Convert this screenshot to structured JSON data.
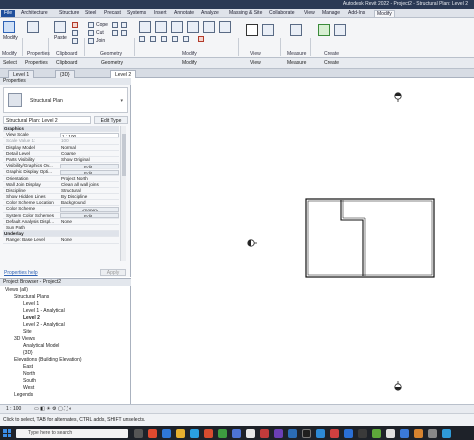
{
  "window": {
    "title": "Autodesk Revit 2022 - Project2 - Structural Plan: Level 2"
  },
  "ribbon_tabs": [
    "File",
    "Architecture",
    "Structure",
    "Steel",
    "Precast",
    "Systems",
    "Insert",
    "Annotate",
    "Analyze",
    "Massing & Site",
    "Collaborate",
    "View",
    "Manage",
    "Add-Ins",
    "Modify"
  ],
  "ribbon": {
    "modify_label": "Modify",
    "properties_label": "Properties",
    "clipboard_label": "Clipboard",
    "geometry_label": "Geometry",
    "modify_group_label": "Modify",
    "view_label": "View",
    "measure_label": "Measure",
    "create_label": "Create",
    "cope": "Cope",
    "cut": "Cut",
    "join": "Join",
    "paste": "Paste"
  },
  "select_bar": {
    "select": "Select",
    "properties": "Properties",
    "clipboard": "Clipboard",
    "geometry": "Geometry",
    "modify": "Modify",
    "view": "View",
    "measure": "Measure",
    "create": "Create"
  },
  "view_tabs": [
    "Level 1",
    "{3D}",
    "Level 2"
  ],
  "properties": {
    "header": "Properties",
    "type_name": "Structural Plan",
    "instance": "Structural Plan: Level 2",
    "edit_type": "Edit Type",
    "rows": [
      {
        "k": "Graphics",
        "v": "",
        "kind": "group"
      },
      {
        "k": "View Scale",
        "v": "1 : 100",
        "kind": "box"
      },
      {
        "k": "Scale Value    1:",
        "v": "100",
        "kind": "dim"
      },
      {
        "k": "Display Model",
        "v": "Normal",
        "kind": "text"
      },
      {
        "k": "Detail Level",
        "v": "Coarse",
        "kind": "text"
      },
      {
        "k": "Parts Visibility",
        "v": "Show Original",
        "kind": "text"
      },
      {
        "k": "Visibility/Graphics Ov...",
        "v": "Edit...",
        "kind": "btn"
      },
      {
        "k": "Graphic Display Opti...",
        "v": "Edit...",
        "kind": "btn"
      },
      {
        "k": "Orientation",
        "v": "Project North",
        "kind": "text"
      },
      {
        "k": "Wall Join Display",
        "v": "Clean all wall joins",
        "kind": "text"
      },
      {
        "k": "Discipline",
        "v": "Structural",
        "kind": "text"
      },
      {
        "k": "Show Hidden Lines",
        "v": "By Discipline",
        "kind": "text"
      },
      {
        "k": "Color Scheme Location",
        "v": "Background",
        "kind": "text"
      },
      {
        "k": "Color Scheme",
        "v": "<none>",
        "kind": "btn"
      },
      {
        "k": "System Color Schemes",
        "v": "Edit...",
        "kind": "btn"
      },
      {
        "k": "Default Analysis Displ...",
        "v": "None",
        "kind": "text"
      },
      {
        "k": "Sun Path",
        "v": "",
        "kind": "text"
      },
      {
        "k": "Underlay",
        "v": "",
        "kind": "group"
      },
      {
        "k": "Range: Base Level",
        "v": "None",
        "kind": "text"
      }
    ],
    "help_link": "Properties help",
    "apply": "Apply"
  },
  "browser": {
    "header": "Project Browser - Project2",
    "tree": [
      {
        "label": "Views (all)",
        "depth": 0,
        "bold": false
      },
      {
        "label": "Structural Plans",
        "depth": 1,
        "bold": false
      },
      {
        "label": "Level 1",
        "depth": 2,
        "bold": false
      },
      {
        "label": "Level 1 - Analytical",
        "depth": 2,
        "bold": false
      },
      {
        "label": "Level 2",
        "depth": 2,
        "bold": true
      },
      {
        "label": "Level 2 - Analytical",
        "depth": 2,
        "bold": false
      },
      {
        "label": "Site",
        "depth": 2,
        "bold": false
      },
      {
        "label": "3D Views",
        "depth": 1,
        "bold": false
      },
      {
        "label": "Analytical Model",
        "depth": 2,
        "bold": false
      },
      {
        "label": "{3D}",
        "depth": 2,
        "bold": false
      },
      {
        "label": "Elevations (Building Elevation)",
        "depth": 1,
        "bold": false
      },
      {
        "label": "East",
        "depth": 2,
        "bold": false
      },
      {
        "label": "North",
        "depth": 2,
        "bold": false
      },
      {
        "label": "South",
        "depth": 2,
        "bold": false
      },
      {
        "label": "West",
        "depth": 2,
        "bold": false
      },
      {
        "label": "Legends",
        "depth": 1,
        "bold": false
      }
    ]
  },
  "status": {
    "scale": "1 : 100",
    "hint": "Click to select, TAB for alternates, CTRL adds, SHIFT unselects."
  },
  "taskbar": {
    "search_placeholder": "Type here to search"
  }
}
